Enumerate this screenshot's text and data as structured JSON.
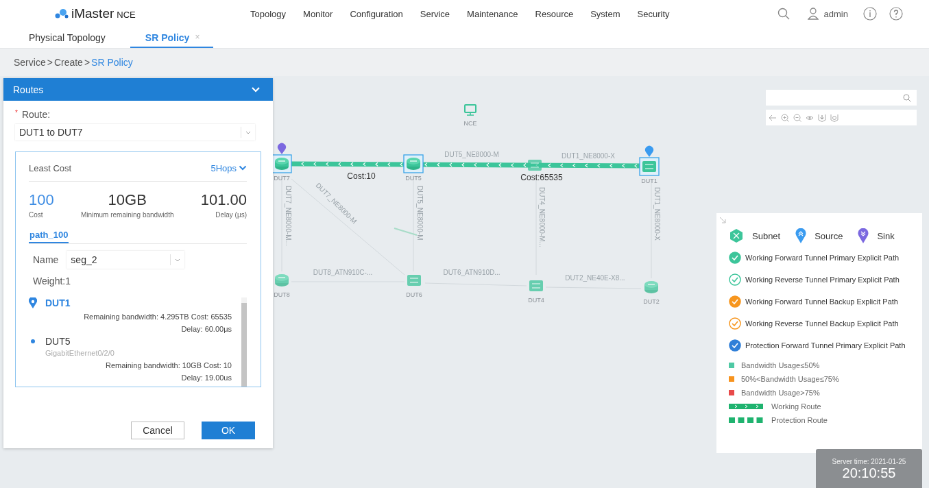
{
  "header": {
    "logo": "iMaster",
    "logo_suffix": "NCE",
    "menu": [
      "Topology",
      "Monitor",
      "Configuration",
      "Service",
      "Maintenance",
      "Resource",
      "System",
      "Security"
    ],
    "user": "admin"
  },
  "tabs": [
    {
      "label": "Physical Topology",
      "selected": false
    },
    {
      "label": "SR Policy",
      "selected": true,
      "close": "×"
    }
  ],
  "breadcrumb": {
    "separator": ">",
    "items": [
      {
        "label": "Service",
        "current": false
      },
      {
        "label": "Create",
        "current": false
      },
      {
        "label": "SR Policy",
        "current": true
      }
    ]
  },
  "routes_panel": {
    "title": "Routes",
    "route_label": "Route:",
    "required_mark": "*",
    "route_value": "DUT1 to DUT7",
    "summary": {
      "title": "Least Cost",
      "hops": "5Hops",
      "metrics": [
        {
          "value": "100",
          "label": "Cost",
          "highlight": true
        },
        {
          "value": "10GB",
          "label": "Minimum remaining bandwidth",
          "highlight": false
        },
        {
          "value": "101.00",
          "label": "Delay (μs)",
          "highlight": false
        }
      ]
    },
    "path_tabs": [
      {
        "label": "path_100",
        "selected": true
      }
    ],
    "name_label": "Name",
    "name_value": "seg_2",
    "weight": "Weight:1",
    "hops": [
      {
        "kind": "endpoint",
        "name": "DUT1",
        "details": [
          "Remaining bandwidth: 4.295TB Cost: 65535",
          "Delay: 60.00μs"
        ]
      },
      {
        "kind": "transit",
        "name": "DUT5",
        "interface": "GigabitEthernet0/2/0",
        "details": [
          "Remaining bandwidth: 10GB Cost: 10",
          "Delay: 19.00us"
        ]
      }
    ],
    "buttons": [
      {
        "label": "Cancel",
        "primary": false
      },
      {
        "label": "OK",
        "primary": true
      }
    ]
  },
  "topology": {
    "nodes": [
      {
        "name": "NCE",
        "kind": "server",
        "selected": false
      },
      {
        "name": "DUT7",
        "kind": "router",
        "selected": true,
        "color": "#7b68e0"
      },
      {
        "name": "DUT5",
        "kind": "router",
        "selected": true
      },
      {
        "kind": "switch",
        "selected": false
      },
      {
        "name": "DUT1",
        "kind": "switch",
        "selected": true,
        "color": "#3a9bf0"
      },
      {
        "name": "DUT8",
        "kind": "router",
        "selected": false
      },
      {
        "name": "DUT6",
        "kind": "switch",
        "selected": false
      },
      {
        "name": "DUT4",
        "kind": "switch",
        "selected": false
      },
      {
        "name": "DUT2",
        "kind": "router",
        "selected": false
      }
    ],
    "link_labels": [
      "DUT5_NE8000-M",
      "DUT1_NE8000-X",
      "DUT7_NE8000-M...",
      "DUT7_NE8000-M",
      "DUT5_NE8000-M",
      "DUT4_NE8000-M...",
      "DUT1_NE8000-X",
      "DUT8_ATN910C-...",
      "DUT6_ATN910D...",
      "DUT2_NE40E-X8..."
    ],
    "costs": [
      "Cost:10",
      "Cost:65535"
    ]
  },
  "legend": {
    "markers": [
      {
        "label": "Subnet",
        "kind": "subnet"
      },
      {
        "label": "Source",
        "kind": "source"
      },
      {
        "label": "Sink",
        "kind": "sink"
      }
    ],
    "paths": [
      {
        "label": "Working Forward Tunnel Primary Explicit Path",
        "color": "#3cc59a",
        "filled": true
      },
      {
        "label": "Working Reverse Tunnel Primary Explicit Path",
        "color": "#3cc59a",
        "filled": false
      },
      {
        "label": "Working Forward Tunnel Backup Explicit Path",
        "color": "#f7961e",
        "filled": true
      },
      {
        "label": "Working Reverse Tunnel Backup Explicit Path",
        "color": "#f7961e",
        "filled": false
      },
      {
        "label": "Protection Forward Tunnel Primary Explicit Path",
        "color": "#2f7fd8",
        "filled": true
      }
    ],
    "usage": [
      {
        "label": "Bandwidth Usage≤50%",
        "color": "#4fc9a4"
      },
      {
        "label": "50%<Bandwidth Usage≤75%",
        "color": "#f7931e"
      },
      {
        "label": "Bandwidth Usage>75%",
        "color": "#e84a4a"
      }
    ],
    "routes": [
      {
        "label": "Working Route",
        "kind": "working"
      },
      {
        "label": "Protection Route",
        "kind": "protection"
      }
    ]
  },
  "server_time": {
    "label": "Server time: 2021-01-25",
    "time": "20:10:55"
  }
}
